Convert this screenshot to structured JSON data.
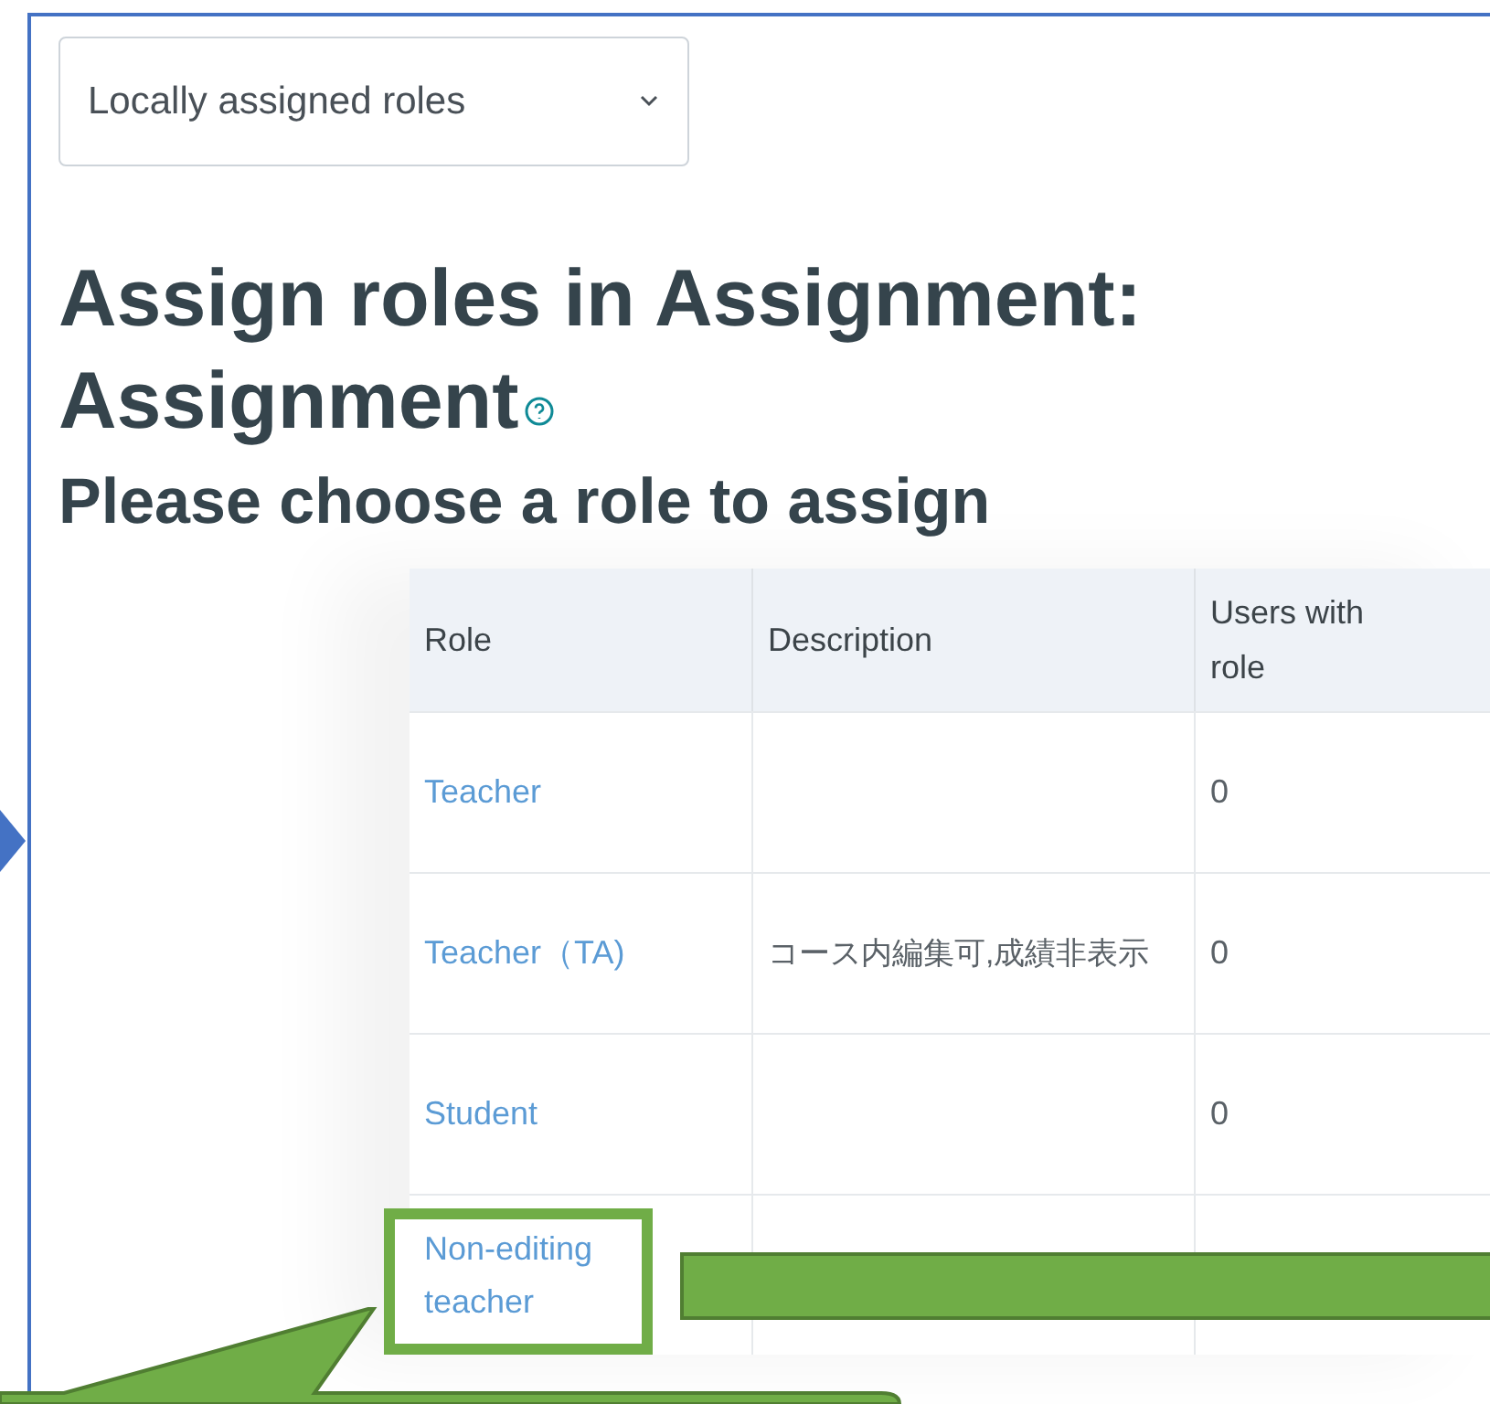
{
  "filter_select": {
    "value": "Locally assigned roles"
  },
  "heading": {
    "title_line_1": "Assign roles in Assignment:",
    "title_line_2": "Assignment"
  },
  "subheading": "Please choose a role to assign",
  "table": {
    "columns": [
      "Role",
      "Description",
      "Users with role"
    ],
    "rows": [
      {
        "role": "Teacher",
        "description": "",
        "users": "0"
      },
      {
        "role": "Teacher（TA)",
        "description": "コース内編集可,成績非表示",
        "users": "0"
      },
      {
        "role": "Student",
        "description": "",
        "users": "0"
      },
      {
        "role": "Non-editing teacher"
      }
    ]
  }
}
